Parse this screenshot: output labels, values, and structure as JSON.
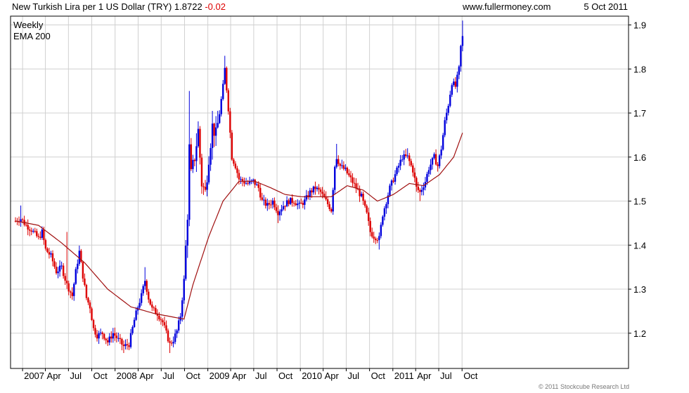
{
  "header": {
    "title": "New Turkish Lira per 1 US Dollar (TRY) 1.8722",
    "change": "-0.02",
    "site": "www.fullermoney.com",
    "date": "5 Oct 2011"
  },
  "copyright": "© 2011 Stockcube Research Ltd",
  "colors": {
    "up": "#0000dd",
    "down": "#dd0000",
    "ema": "#a01010",
    "grid": "#d0d0d0",
    "change_text": "#dd0000",
    "legend_weekly": "#1010b0",
    "legend_ema": "#a01010"
  },
  "chart_data": {
    "type": "candlestick-bar",
    "interval": "weekly",
    "start_date": "2006-12-04",
    "ylim": [
      1.12,
      1.92
    ],
    "yticks": [
      1.2,
      1.3,
      1.4,
      1.5,
      1.6,
      1.7,
      1.8,
      1.9
    ],
    "ytick_labels": [
      "1.2",
      "1.3",
      "1.4",
      "1.5",
      "1.6",
      "1.7",
      "1.8",
      "1.9"
    ],
    "xtick_labels": [
      "2007",
      "Apr",
      "Jul",
      "Oct",
      "2008",
      "Apr",
      "Jul",
      "Oct",
      "2009",
      "Apr",
      "Jul",
      "Oct",
      "2010",
      "Apr",
      "Jul",
      "Oct",
      "2011",
      "Apr",
      "Jul",
      "Oct"
    ],
    "xtick_dates": [
      "2007-01-01",
      "2007-04-01",
      "2007-07-01",
      "2007-10-01",
      "2008-01-01",
      "2008-04-01",
      "2008-07-01",
      "2008-10-01",
      "2009-01-01",
      "2009-04-01",
      "2009-07-01",
      "2009-10-01",
      "2010-01-01",
      "2010-04-01",
      "2010-07-01",
      "2010-10-01",
      "2011-01-01",
      "2011-04-01",
      "2011-07-01",
      "2011-10-01"
    ],
    "legend": [
      "Weekly",
      "EMA 200"
    ],
    "legend_position": "top-left",
    "grid": true,
    "close_anchors": [
      [
        "2006-12-04",
        1.455
      ],
      [
        "2006-12-25",
        1.46
      ],
      [
        "2007-01-15",
        1.445
      ],
      [
        "2007-02-05",
        1.435
      ],
      [
        "2007-03-05",
        1.415
      ],
      [
        "2007-03-19",
        1.43
      ],
      [
        "2007-04-02",
        1.39
      ],
      [
        "2007-04-23",
        1.375
      ],
      [
        "2007-05-14",
        1.34
      ],
      [
        "2007-06-04",
        1.35
      ],
      [
        "2007-06-25",
        1.31
      ],
      [
        "2007-07-16",
        1.285
      ],
      [
        "2007-07-30",
        1.34
      ],
      [
        "2007-08-13",
        1.385
      ],
      [
        "2007-08-27",
        1.33
      ],
      [
        "2007-09-10",
        1.28
      ],
      [
        "2007-09-24",
        1.26
      ],
      [
        "2007-10-08",
        1.21
      ],
      [
        "2007-10-22",
        1.195
      ],
      [
        "2007-11-12",
        1.2
      ],
      [
        "2007-12-03",
        1.18
      ],
      [
        "2007-12-24",
        1.2
      ],
      [
        "2008-01-14",
        1.185
      ],
      [
        "2008-02-04",
        1.17
      ],
      [
        "2008-02-25",
        1.175
      ],
      [
        "2008-03-17",
        1.23
      ],
      [
        "2008-03-31",
        1.26
      ],
      [
        "2008-04-14",
        1.285
      ],
      [
        "2008-04-28",
        1.32
      ],
      [
        "2008-05-12",
        1.28
      ],
      [
        "2008-05-26",
        1.255
      ],
      [
        "2008-06-16",
        1.245
      ],
      [
        "2008-07-07",
        1.225
      ],
      [
        "2008-07-21",
        1.2
      ],
      [
        "2008-08-04",
        1.175
      ],
      [
        "2008-08-18",
        1.185
      ],
      [
        "2008-09-01",
        1.205
      ],
      [
        "2008-09-15",
        1.24
      ],
      [
        "2008-09-29",
        1.32
      ],
      [
        "2008-10-13",
        1.47
      ],
      [
        "2008-10-20",
        1.62
      ],
      [
        "2008-10-27",
        1.56
      ],
      [
        "2008-11-10",
        1.6
      ],
      [
        "2008-11-24",
        1.66
      ],
      [
        "2008-12-08",
        1.54
      ],
      [
        "2008-12-22",
        1.52
      ],
      [
        "2009-01-05",
        1.6
      ],
      [
        "2009-01-19",
        1.67
      ],
      [
        "2009-02-02",
        1.65
      ],
      [
        "2009-02-16",
        1.7
      ],
      [
        "2009-03-02",
        1.76
      ],
      [
        "2009-03-09",
        1.8
      ],
      [
        "2009-03-23",
        1.71
      ],
      [
        "2009-04-06",
        1.6
      ],
      [
        "2009-04-20",
        1.58
      ],
      [
        "2009-05-04",
        1.55
      ],
      [
        "2009-05-18",
        1.545
      ],
      [
        "2009-06-08",
        1.54
      ],
      [
        "2009-06-29",
        1.545
      ],
      [
        "2009-07-20",
        1.53
      ],
      [
        "2009-08-03",
        1.5
      ],
      [
        "2009-08-24",
        1.49
      ],
      [
        "2009-09-14",
        1.5
      ],
      [
        "2009-10-05",
        1.475
      ],
      [
        "2009-10-26",
        1.49
      ],
      [
        "2009-11-16",
        1.5
      ],
      [
        "2009-12-07",
        1.5
      ],
      [
        "2009-12-28",
        1.49
      ],
      [
        "2010-01-18",
        1.5
      ],
      [
        "2010-02-08",
        1.52
      ],
      [
        "2010-03-01",
        1.53
      ],
      [
        "2010-03-22",
        1.52
      ],
      [
        "2010-04-12",
        1.5
      ],
      [
        "2010-05-03",
        1.48
      ],
      [
        "2010-05-17",
        1.58
      ],
      [
        "2010-05-24",
        1.6
      ],
      [
        "2010-06-07",
        1.58
      ],
      [
        "2010-06-28",
        1.57
      ],
      [
        "2010-07-19",
        1.55
      ],
      [
        "2010-08-09",
        1.53
      ],
      [
        "2010-08-30",
        1.51
      ],
      [
        "2010-09-20",
        1.47
      ],
      [
        "2010-10-04",
        1.43
      ],
      [
        "2010-10-18",
        1.42
      ],
      [
        "2010-11-08",
        1.415
      ],
      [
        "2010-11-22",
        1.47
      ],
      [
        "2010-12-06",
        1.5
      ],
      [
        "2010-12-20",
        1.53
      ],
      [
        "2011-01-03",
        1.55
      ],
      [
        "2011-01-17",
        1.57
      ],
      [
        "2011-02-07",
        1.6
      ],
      [
        "2011-02-28",
        1.6
      ],
      [
        "2011-03-21",
        1.57
      ],
      [
        "2011-04-04",
        1.53
      ],
      [
        "2011-04-18",
        1.52
      ],
      [
        "2011-05-09",
        1.545
      ],
      [
        "2011-05-23",
        1.575
      ],
      [
        "2011-06-13",
        1.6
      ],
      [
        "2011-06-27",
        1.58
      ],
      [
        "2011-07-11",
        1.62
      ],
      [
        "2011-07-25",
        1.68
      ],
      [
        "2011-08-08",
        1.72
      ],
      [
        "2011-08-22",
        1.77
      ],
      [
        "2011-09-05",
        1.76
      ],
      [
        "2011-09-19",
        1.8
      ],
      [
        "2011-09-26",
        1.85
      ],
      [
        "2011-10-03",
        1.8722
      ]
    ],
    "ema_anchors": [
      [
        "2006-12-04",
        1.455
      ],
      [
        "2007-03-05",
        1.445
      ],
      [
        "2007-06-04",
        1.405
      ],
      [
        "2007-09-03",
        1.36
      ],
      [
        "2007-12-03",
        1.3
      ],
      [
        "2008-03-03",
        1.26
      ],
      [
        "2008-06-02",
        1.245
      ],
      [
        "2008-09-01",
        1.235
      ],
      [
        "2008-09-29",
        1.232
      ],
      [
        "2008-11-03",
        1.31
      ],
      [
        "2009-01-05",
        1.42
      ],
      [
        "2009-03-02",
        1.5
      ],
      [
        "2009-05-04",
        1.545
      ],
      [
        "2009-07-06",
        1.545
      ],
      [
        "2009-09-07",
        1.53
      ],
      [
        "2009-11-02",
        1.515
      ],
      [
        "2010-01-04",
        1.51
      ],
      [
        "2010-03-01",
        1.51
      ],
      [
        "2010-05-03",
        1.51
      ],
      [
        "2010-07-05",
        1.535
      ],
      [
        "2010-09-06",
        1.525
      ],
      [
        "2010-11-01",
        1.5
      ],
      [
        "2011-01-03",
        1.515
      ],
      [
        "2011-03-07",
        1.54
      ],
      [
        "2011-05-02",
        1.535
      ],
      [
        "2011-07-04",
        1.56
      ],
      [
        "2011-08-29",
        1.6
      ],
      [
        "2011-10-03",
        1.655
      ]
    ],
    "notable_highs": [
      [
        "2006-12-25",
        1.49
      ],
      [
        "2007-06-25",
        1.43
      ],
      [
        "2008-04-28",
        1.35
      ],
      [
        "2008-10-20",
        1.75
      ],
      [
        "2009-03-09",
        1.83
      ],
      [
        "2010-05-24",
        1.63
      ],
      [
        "2011-02-28",
        1.62
      ],
      [
        "2011-10-03",
        1.91
      ]
    ],
    "notable_lows": [
      [
        "2008-02-04",
        1.155
      ],
      [
        "2008-08-04",
        1.155
      ],
      [
        "2009-10-05",
        1.45
      ],
      [
        "2010-11-08",
        1.39
      ],
      [
        "2011-04-18",
        1.5
      ]
    ]
  }
}
